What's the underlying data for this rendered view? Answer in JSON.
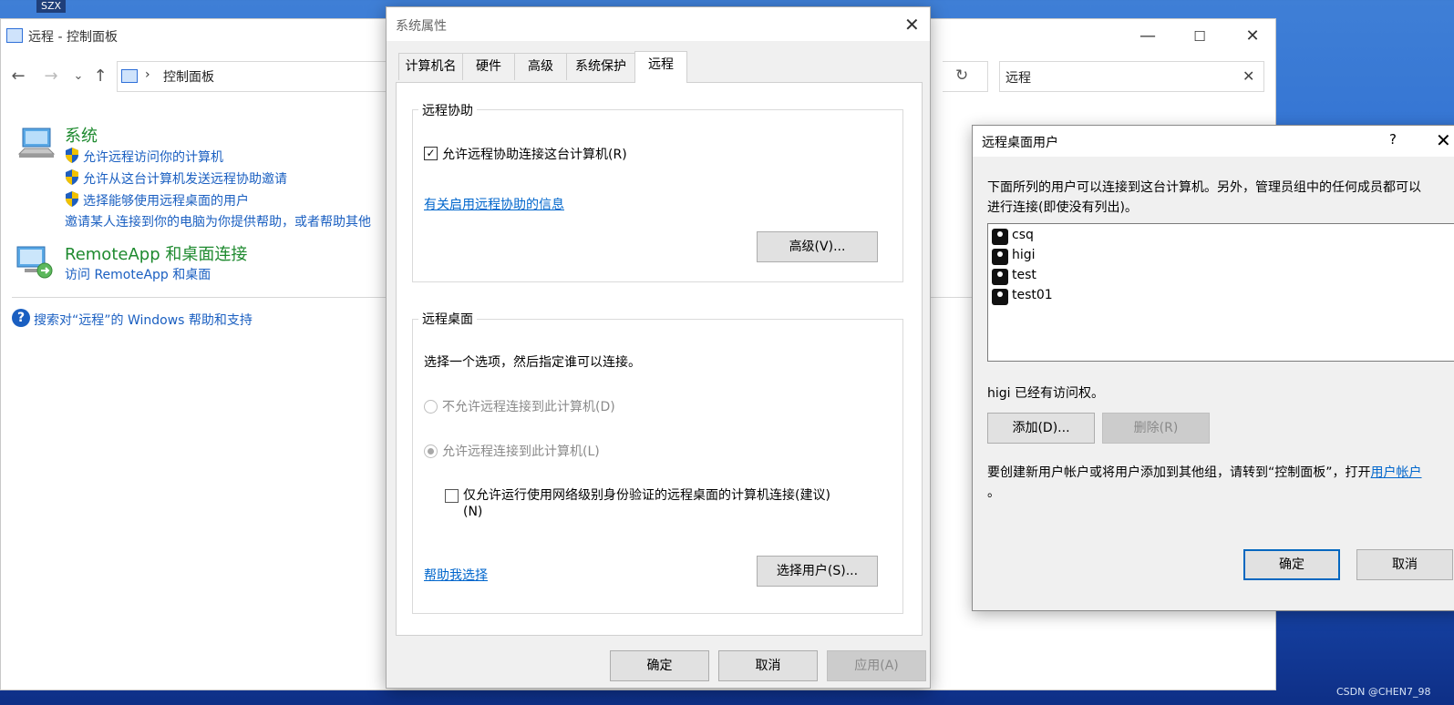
{
  "desktop": {
    "label": "SZX"
  },
  "control_panel": {
    "title": "远程 - 控制面板",
    "window_buttons": {
      "minimize": "—",
      "maximize": "☐",
      "close": "✕"
    },
    "nav": {
      "back": "←",
      "forward": "→",
      "recent": "⌄",
      "up": "↑"
    },
    "address": {
      "separator": "›",
      "path": "控制面板"
    },
    "refresh": "↻",
    "search": {
      "value": "远程",
      "clear": "✕"
    },
    "sections": [
      {
        "icon": "system-computer-icon",
        "heading": "系统",
        "links": [
          "允许远程访问你的计算机",
          "允许从这台计算机发送远程协助邀请",
          "选择能够使用远程桌面的用户"
        ],
        "extra": "邀请某人连接到你的电脑为你提供帮助，或者帮助其他"
      },
      {
        "icon": "remoteapp-icon",
        "heading": "RemoteApp 和桌面连接",
        "links": [
          "访问 RemoteApp 和桌面"
        ]
      }
    ],
    "help": {
      "icon": "?",
      "text": "搜索对“远程”的 Windows 帮助和支持"
    }
  },
  "system_properties": {
    "title": "系统属性",
    "close": "✕",
    "tabs": [
      "计算机名",
      "硬件",
      "高级",
      "系统保护",
      "远程"
    ],
    "active_tab": "远程",
    "remote_assistance": {
      "group_label": "远程协助",
      "checkbox_label": "允许远程协助连接这台计算机(R)",
      "checkbox_mark": "✓",
      "info_link": "有关启用远程协助的信息",
      "advanced_button": "高级(V)..."
    },
    "remote_desktop": {
      "group_label": "远程桌面",
      "instruction": "选择一个选项，然后指定谁可以连接。",
      "option_deny": "不允许远程连接到此计算机(D)",
      "option_allow": "允许远程连接到此计算机(L)",
      "nla_checkbox_label": "仅允许运行使用网络级别身份验证的远程桌面的计算机连接(建议)",
      "nla_checkbox_label_2": "(N)",
      "help_link": "帮助我选择",
      "select_users_button": "选择用户(S)..."
    },
    "buttons": {
      "ok": "确定",
      "cancel": "取消",
      "apply": "应用(A)"
    }
  },
  "remote_desktop_users": {
    "title": "远程桌面用户",
    "help": "?",
    "close": "✕",
    "description_line1": "下面所列的用户可以连接到这台计算机。另外，管理员组中的任何成员都可以",
    "description_line2": "进行连接(即使没有列出)。",
    "users": [
      "csq",
      "higi",
      "test",
      "test01"
    ],
    "status": "higi 已经有访问权。",
    "add_button": "添加(D)...",
    "remove_button": "删除(R)",
    "note_text": "要创建新用户帐户或将用户添加到其他组，请转到“控制面板”，打开",
    "note_link": "用户帐户",
    "note_end": "。",
    "ok_button": "确定",
    "cancel_button": "取消"
  },
  "watermark": "CSDN @CHEN7_98"
}
